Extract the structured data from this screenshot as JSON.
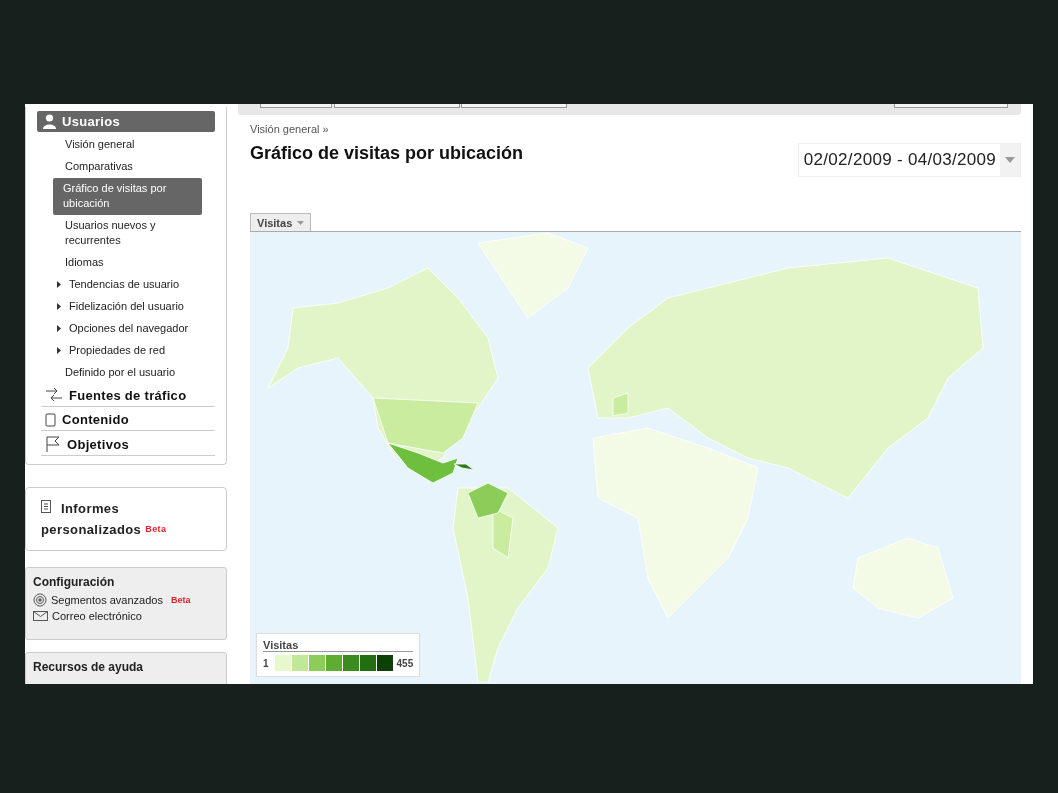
{
  "sidebar": {
    "sections": [
      {
        "label": "Usuarios",
        "selected": true,
        "items": [
          {
            "label": "Visión general",
            "selected": false,
            "expandable": false
          },
          {
            "label": "Comparativas",
            "selected": false,
            "expandable": false
          },
          {
            "label": "Gráfico de visitas por ubicación",
            "selected": true,
            "expandable": false
          },
          {
            "label": "Usuarios nuevos y recurrentes",
            "selected": false,
            "expandable": false
          },
          {
            "label": "Idiomas",
            "selected": false,
            "expandable": false
          },
          {
            "label": "Tendencias de usuario",
            "selected": false,
            "expandable": true
          },
          {
            "label": "Fidelización del usuario",
            "selected": false,
            "expandable": true
          },
          {
            "label": "Opciones del navegador",
            "selected": false,
            "expandable": true
          },
          {
            "label": "Propiedades de red",
            "selected": false,
            "expandable": true
          },
          {
            "label": "Definido por el usuario",
            "selected": false,
            "expandable": false
          }
        ]
      },
      {
        "label": "Fuentes de tráfico",
        "selected": false
      },
      {
        "label": "Contenido",
        "selected": false
      },
      {
        "label": "Objetivos",
        "selected": false
      }
    ],
    "custom_reports": {
      "label": "Informes personalizados",
      "badge": "Beta"
    },
    "settings": {
      "title": "Configuración",
      "links": [
        {
          "label": "Segmentos avanzados",
          "badge": "Beta"
        },
        {
          "label": "Correo electrónico"
        }
      ]
    },
    "help": {
      "title": "Recursos de ayuda"
    }
  },
  "main": {
    "breadcrumb": "Visión general »",
    "title": "Gráfico de visitas por ubicación",
    "date_range": "02/02/2009 - 04/03/2009",
    "metric_tab": "Visitas",
    "legend": {
      "title": "Visitas",
      "min": "1",
      "max": "455",
      "steps": [
        {
          "color": "#e6f8cc"
        },
        {
          "color": "#bfe898"
        },
        {
          "color": "#8ccd5a"
        },
        {
          "color": "#5cad30"
        },
        {
          "color": "#3a8d1c"
        },
        {
          "color": "#226e12"
        },
        {
          "color": "#0d3f07"
        }
      ]
    }
  }
}
